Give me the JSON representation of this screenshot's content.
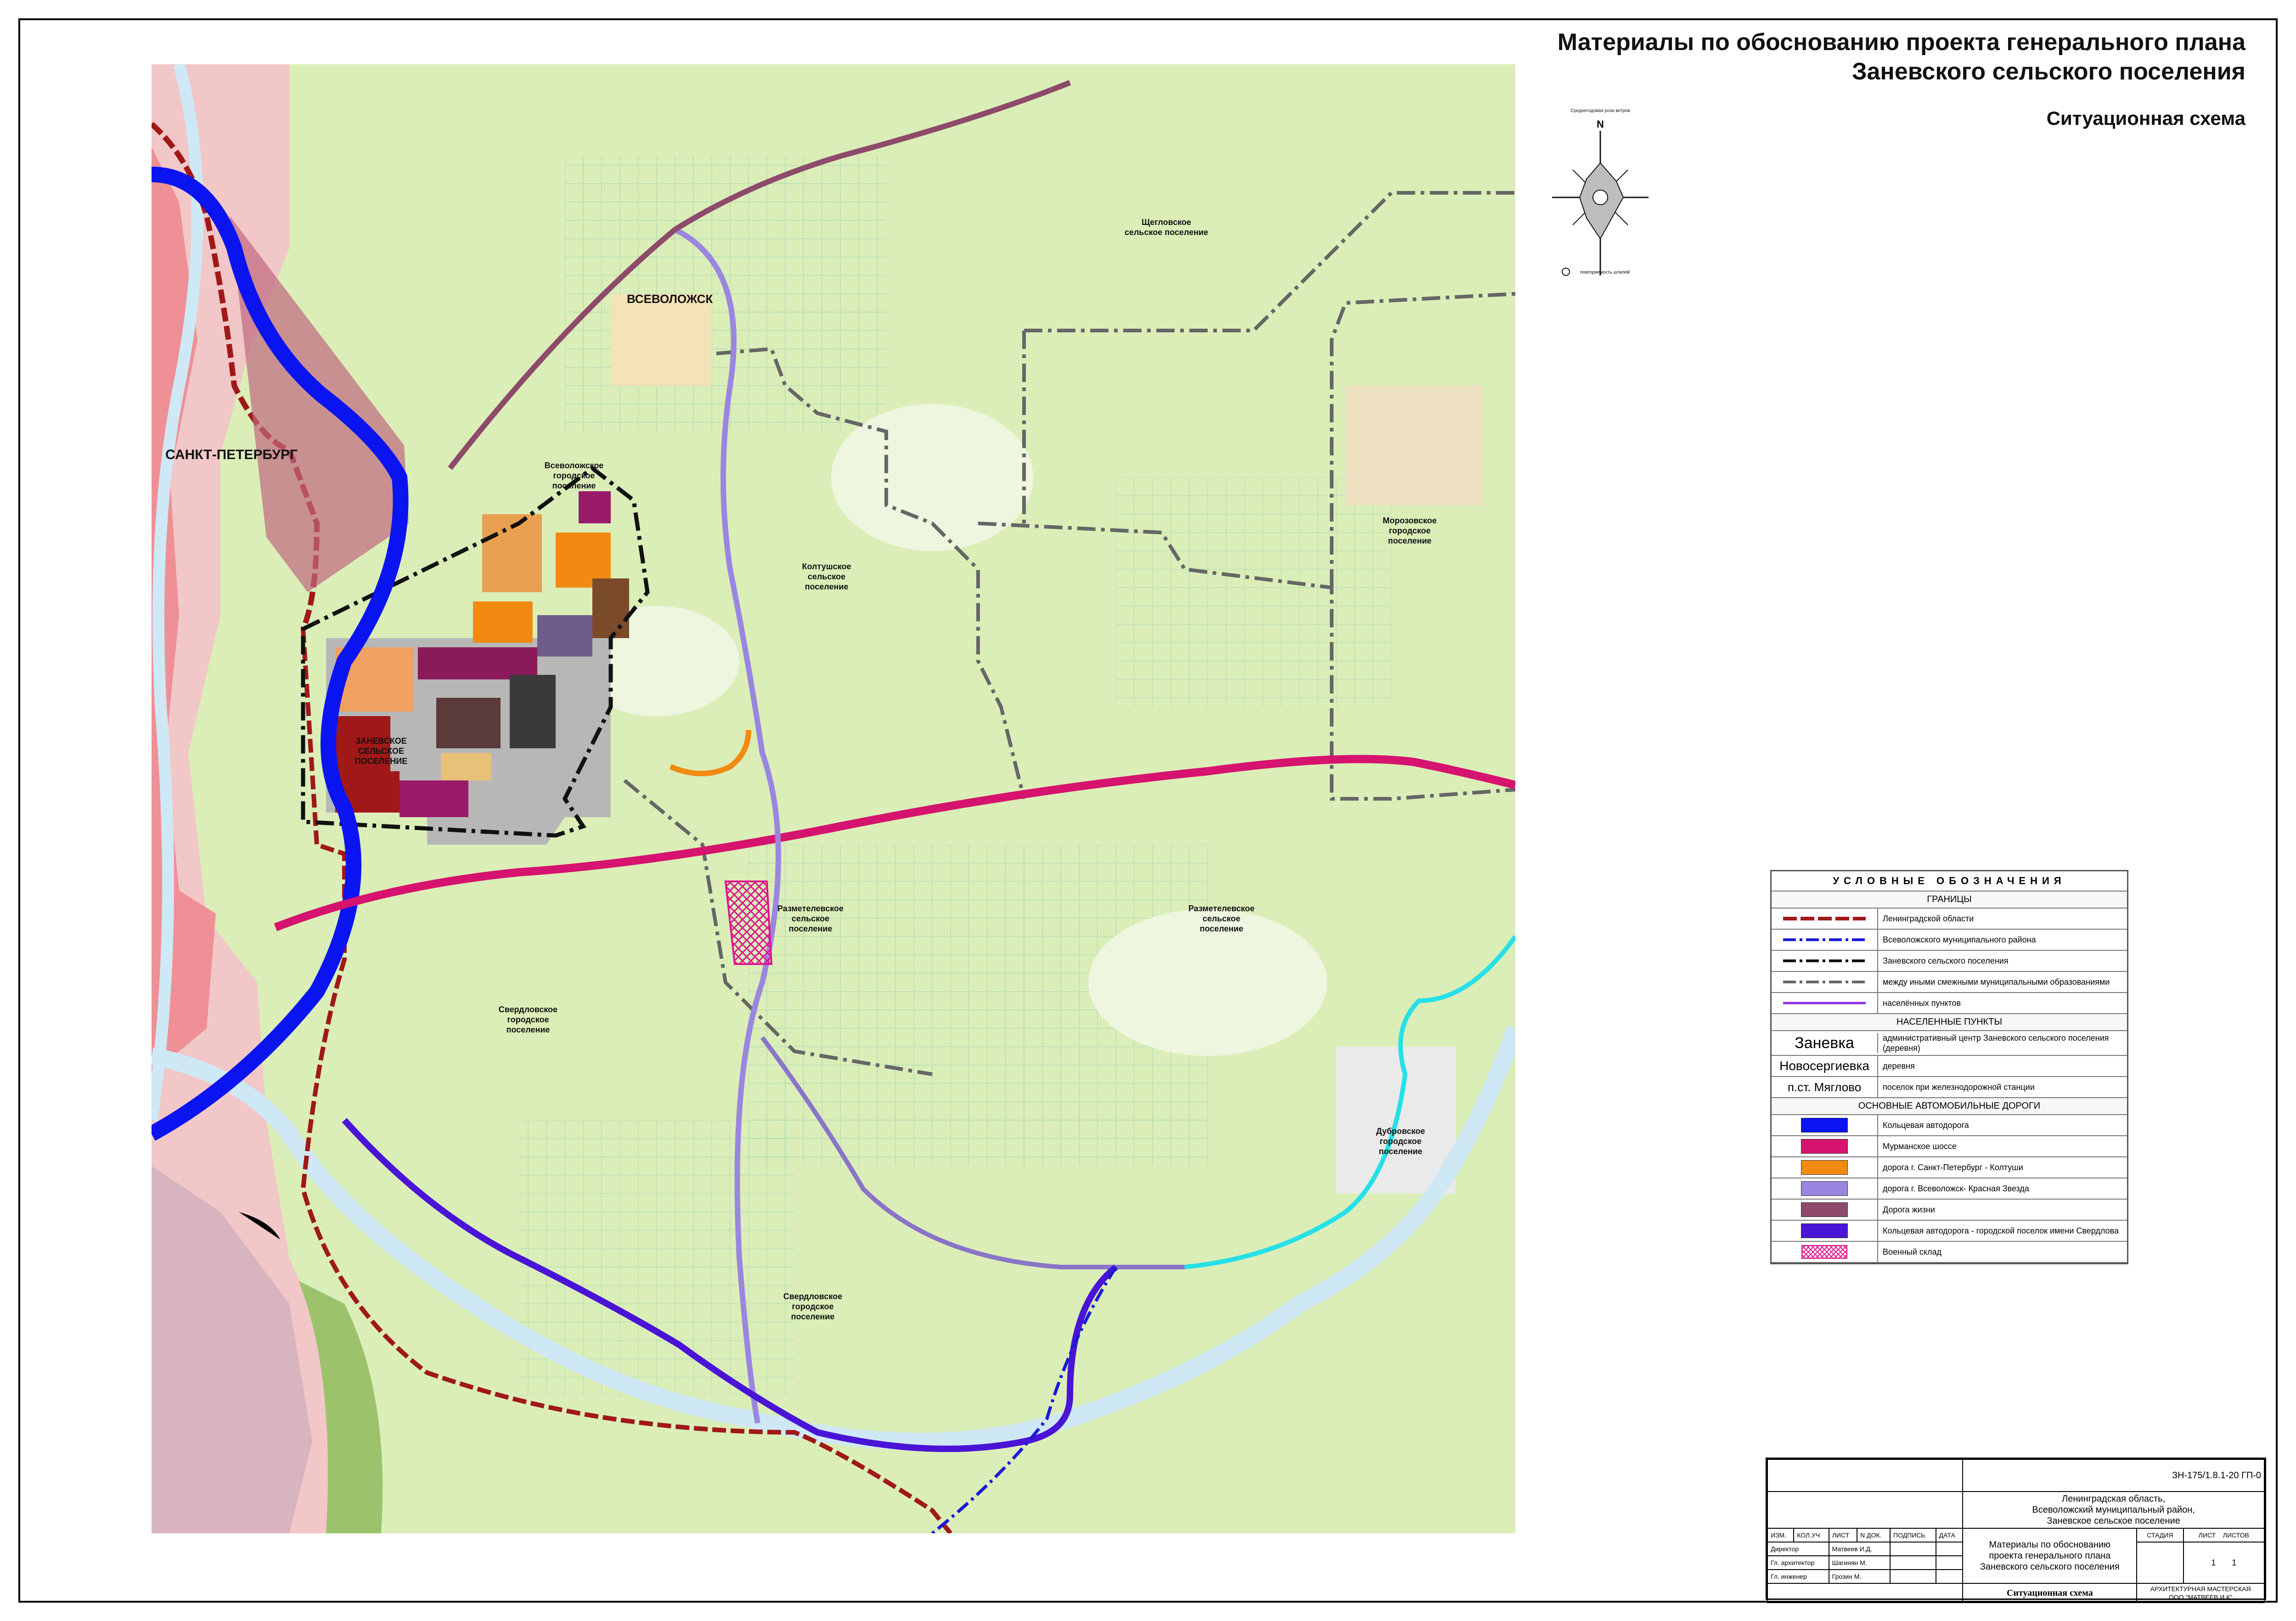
{
  "title": {
    "line1": "Материалы по обоснованию проекта генерального плана",
    "line2": "Заневского сельского поселения",
    "subtitle": "Ситуационная схема"
  },
  "compass": {
    "north": "N",
    "label_top": "Среднегодовая роза ветров",
    "label_bottom": "повторяемость штилей"
  },
  "map_labels": {
    "spb": "САНКТ-ПЕТЕРБУРГ",
    "vsevolozhsk": "ВСЕВОЛОЖСК",
    "zanevskoe": [
      "ЗАНЕВСКОЕ",
      "СЕЛЬСКОЕ",
      "ПОСЕЛЕНИЕ"
    ],
    "vsevolozhskoe_gp": [
      "Всеволожское",
      "городское",
      "поселение"
    ],
    "koltushskoe": [
      "Колтушское",
      "сельское",
      "поселение"
    ],
    "shcheglovskoe": [
      "Щегловское",
      "сельское поселение"
    ],
    "morozovskoe": [
      "Морозовское",
      "городское",
      "поселение"
    ],
    "razmetelevskoe_west": [
      "Разметелевское",
      "сельское",
      "поселение"
    ],
    "razmetelevskoe_east": [
      "Разметелевское",
      "сельское",
      "поселение"
    ],
    "sverdlovskoe_west": [
      "Свердловское",
      "городское",
      "поселение"
    ],
    "sverdlovskoe_south": [
      "Свердловское",
      "городское",
      "поселение"
    ],
    "dubrovskoe": [
      "Дубровское",
      "городское",
      "поселение"
    ]
  },
  "legend": {
    "header": "УСЛОВНЫЕ ОБОЗНАЧЕНИЯ",
    "section_borders": "ГРАНИЦЫ",
    "borders": [
      {
        "label": "Ленинградской области",
        "color": "#a01818"
      },
      {
        "label": "Всеволожского муниципального района",
        "color": "#1a1ad6"
      },
      {
        "label": "Заневского сельского поселения",
        "color": "#111111"
      },
      {
        "label": "между иными смежными муниципальными образованиями",
        "color": "#666666"
      },
      {
        "label": "населённых пунктов",
        "color": "#8a2be2"
      }
    ],
    "section_settlements": "НАСЕЛЕННЫЕ ПУНКТЫ",
    "settlements": [
      {
        "symbol": "Заневка",
        "label": "административный центр Заневского сельского поселения (деревня)"
      },
      {
        "symbol": "Новосергиевка",
        "label": "деревня"
      },
      {
        "symbol": "п.ст. Мяглово",
        "label": "поселок при железнодорожной станции"
      }
    ],
    "section_roads": "ОСНОВНЫЕ АВТОМОБИЛЬНЫЕ ДОРОГИ",
    "roads": [
      {
        "label": "Кольцевая автодорога",
        "color": "#0a14f0"
      },
      {
        "label": "Мурманское шоссе",
        "color": "#d6136e"
      },
      {
        "label": "дорога г. Санкт-Петербург - Колтуши",
        "color": "#f28a12"
      },
      {
        "label": "дорога г. Всеволожск- Красная Звезда",
        "color": "#9a86e0"
      },
      {
        "label": "Дорога жизни",
        "color": "#8e4a6a"
      },
      {
        "label": "Кольцевая автодорога - городской поселок имени Свердлова",
        "color": "#4a14d6"
      },
      {
        "label": "Военный склад",
        "color": "#f0a0d0"
      }
    ]
  },
  "stamp": {
    "code": "ЗН-175/1.8.1-20   ГП-0",
    "region": [
      "Ленинградская область,",
      "Всеволожский муниципальный район,",
      "Заневское сельское поселение"
    ],
    "cols": [
      "ИЗМ.",
      "КОЛ.УЧ",
      "ЛИСТ",
      "N ДОК.",
      "ПОДПИСЬ",
      "ДАТА"
    ],
    "roles": [
      {
        "role": "Директор",
        "name": "Матвеев И.Д."
      },
      {
        "role": "Гл. архитектор",
        "name": "Шагинян М."
      },
      {
        "role": "Гл. инженер",
        "name": "Грозин М."
      }
    ],
    "project": [
      "Материалы по обоснованию",
      "проекта генерального плана",
      "Заневского сельского поселения"
    ],
    "stage_label": "СТАДИЯ",
    "sheet_label": "ЛИСТ",
    "sheets_label": "ЛИСТОВ",
    "sheet": "1",
    "sheets": "1",
    "drawing": "Ситуационная схема",
    "firm": [
      "АРХИТЕКТУРНАЯ МАСТЕРСКАЯ",
      "ООО \"МАТВЕЕВ И К\""
    ]
  }
}
